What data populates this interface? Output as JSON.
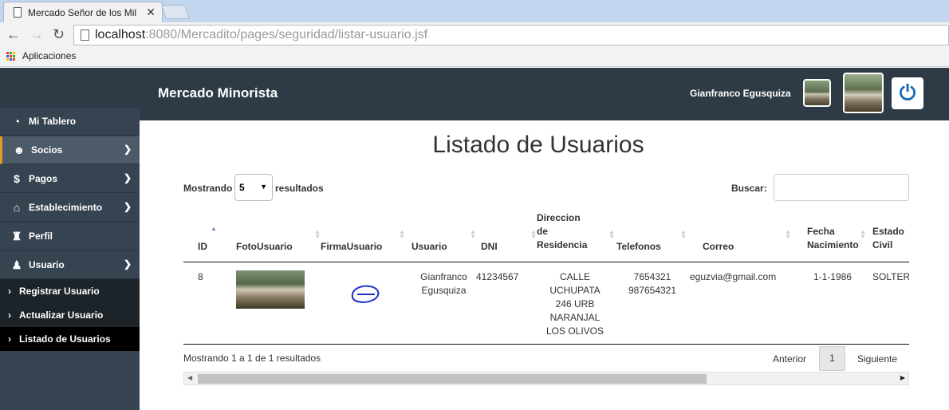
{
  "browser": {
    "tab_title": "Mercado Señor de los Mil",
    "url_host": "localhost",
    "url_rest": ":8080/Mercadito/pages/seguridad/listar-usuario.jsf",
    "bookmark_apps": "Aplicaciones"
  },
  "header": {
    "brand": "Mercado Minorista",
    "user_name": "Gianfranco  Egusquiza",
    "power_icon": "power-icon"
  },
  "sidebar": {
    "items": [
      {
        "label": "Mi Tablero",
        "icon": "dashboard-icon"
      },
      {
        "label": "Socios",
        "icon": "users-icon"
      },
      {
        "label": "Pagos",
        "icon": "dollar-icon"
      },
      {
        "label": "Establecimiento",
        "icon": "bank-icon"
      },
      {
        "label": "Perfil",
        "icon": "user-secret-icon"
      },
      {
        "label": "Usuario",
        "icon": "user-icon"
      }
    ],
    "subitems": [
      "Registrar Usuario",
      "Actualizar Usuario",
      "Listado de Usuarios"
    ]
  },
  "main": {
    "title": "Listado de Usuarios",
    "length_label": "Mostrando",
    "length_value": "5",
    "length_suffix": "resultados",
    "search_label": "Buscar:",
    "columns": [
      "ID",
      "FotoUsuario",
      "FirmaUsuario",
      "Usuario",
      "DNI",
      "Direccion de Residencia",
      "Telefonos",
      "Correo",
      "Fecha Nacimiento",
      "Estado Civil"
    ],
    "rows": [
      {
        "id": "8",
        "usuario": "Gianfranco Egusquiza",
        "dni": "41234567",
        "direccion": "CALLE UCHUPATA 246 URB NARANJAL LOS OLIVOS",
        "telefonos": "7654321 987654321",
        "correo": "eguzvia@gmail.com",
        "fecha": "1-1-1986",
        "estado": "SOLTERO"
      }
    ],
    "info": "Mostrando 1 a 1 de 1 resultados",
    "prev": "Anterior",
    "page": "1",
    "next": "Siguiente"
  },
  "colors": {
    "topbar": "#2e3b47",
    "sidebar": "#364451",
    "accent": "#e09c2b",
    "power": "#1e6fb8"
  }
}
